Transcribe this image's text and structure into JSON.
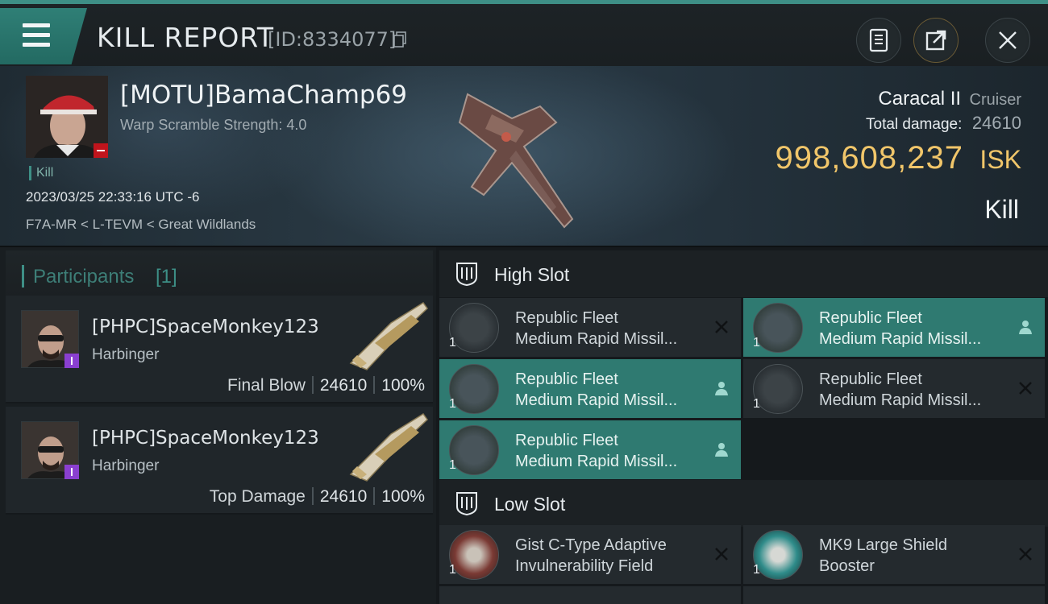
{
  "header": {
    "title": "KILL REPORT",
    "report_id": "[ID:8334077]",
    "buttons": {
      "menu_icon": "hamburger-icon",
      "clipboard_icon": "clipboard-icon",
      "share_icon": "share-icon",
      "close_icon": "close-icon"
    }
  },
  "victim": {
    "name": "[MOTU]BamaChamp69",
    "warp_scramble": "Warp Scramble Strength: 4.0",
    "kill_tag": "Kill",
    "datetime": "2023/03/25 22:33:16 UTC -6",
    "location": "F7A-MR < L-TEVM < Great Wildlands",
    "ship": "Caracal II",
    "ship_class": "Cruiser",
    "total_damage_label": "Total damage:",
    "total_damage": "24610",
    "isk_value": "998,608,237",
    "isk_unit": "ISK",
    "result": "Kill"
  },
  "participants": {
    "title": "Participants",
    "count": "[1]",
    "rows": [
      {
        "name": "[PHPC]SpaceMonkey123",
        "ship": "Harbinger",
        "label": "Final Blow",
        "damage": "24610",
        "percent": "100%"
      },
      {
        "name": "[PHPC]SpaceMonkey123",
        "ship": "Harbinger",
        "label": "Top Damage",
        "damage": "24610",
        "percent": "100%"
      }
    ]
  },
  "slots": {
    "high": {
      "title": "High Slot",
      "modules": [
        {
          "line1": "Republic Fleet",
          "line2": "Medium Rapid Missil...",
          "qty": "1",
          "status": "destroyed",
          "active": false
        },
        {
          "line1": "Republic Fleet",
          "line2": "Medium Rapid Missil...",
          "qty": "1",
          "status": "dropped",
          "active": true
        },
        {
          "line1": "Republic Fleet",
          "line2": "Medium Rapid Missil...",
          "qty": "1",
          "status": "dropped",
          "active": true
        },
        {
          "line1": "Republic Fleet",
          "line2": "Medium Rapid Missil...",
          "qty": "1",
          "status": "destroyed",
          "active": false
        },
        {
          "line1": "Republic Fleet",
          "line2": "Medium Rapid Missil...",
          "qty": "1",
          "status": "dropped",
          "active": true
        }
      ]
    },
    "low": {
      "title": "Low Slot",
      "modules": [
        {
          "line1": "Gist C-Type Adaptive",
          "line2": "Invulnerability Field",
          "qty": "1",
          "status": "destroyed",
          "active": false
        },
        {
          "line1": "MK9 Large Shield",
          "line2": "Booster",
          "qty": "1",
          "status": "destroyed",
          "active": false
        }
      ]
    }
  },
  "colors": {
    "accent": "#3e8f86",
    "isk": "#f1c66a",
    "active_module": "#2f7a71",
    "badge_red": "#c0141c",
    "badge_purple": "#8a3fd0"
  }
}
